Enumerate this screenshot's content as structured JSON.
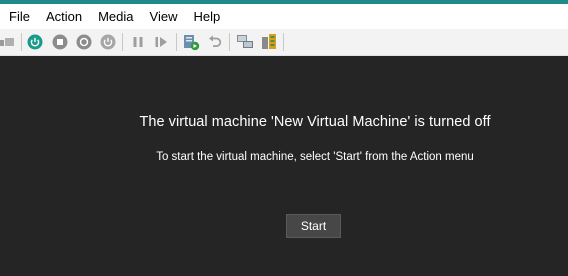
{
  "menu": {
    "items": [
      "File",
      "Action",
      "Media",
      "View",
      "Help"
    ]
  },
  "toolbar": {
    "buttons": [
      {
        "icon": "ctrl-alt-del-icon"
      },
      {
        "icon": "power-on-icon",
        "color": "#1a9a8a"
      },
      {
        "icon": "turn-off-icon"
      },
      {
        "icon": "shut-down-icon"
      },
      {
        "icon": "save-state-icon"
      },
      {
        "icon": "pause-icon"
      },
      {
        "icon": "resume-icon"
      },
      {
        "icon": "checkpoint-icon"
      },
      {
        "icon": "revert-icon"
      },
      {
        "icon": "enhanced-session-icon"
      },
      {
        "icon": "share-icon"
      }
    ]
  },
  "vm_status": {
    "title": "The virtual machine 'New Virtual Machine' is turned off",
    "subtitle": "To start the virtual machine, select 'Start' from the Action menu",
    "start_label": "Start"
  },
  "colors": {
    "accent": "#1e8a8a",
    "background": "#252525",
    "button_bg": "#474747"
  }
}
